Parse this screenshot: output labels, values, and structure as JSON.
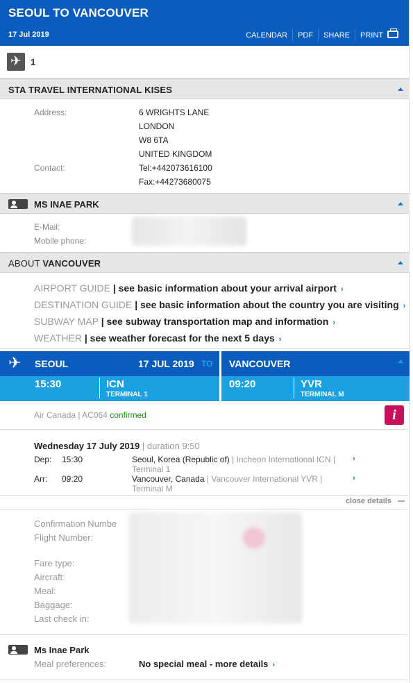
{
  "header": {
    "title": "SEOUL TO VANCOUVER",
    "date": "17 Jul 2019",
    "actions": [
      "CALENDAR",
      "PDF",
      "SHARE",
      "PRINT"
    ]
  },
  "flight_count": "1",
  "agency": {
    "title": "STA TRAVEL INTERNATIONAL KISES",
    "address_label": "Address:",
    "address_lines": [
      "6 WRIGHTS LANE",
      "LONDON",
      "W8 6TA",
      "UNITED KINGDOM"
    ],
    "contact_label": "Contact:",
    "tel": "Tel:+442073616100",
    "fax": "Fax:+44273680075"
  },
  "traveller": {
    "title": "MS INAE PARK",
    "email_label": "E-Mail:",
    "mobile_label": "Mobile phone:"
  },
  "about": {
    "prefix": "ABOUT ",
    "city": "VANCOUVER",
    "guides": [
      {
        "name": "AIRPORT GUIDE",
        "text": "| see basic information about your arrival airport"
      },
      {
        "name": "DESTINATION GUIDE",
        "text": "| see basic information about the country you are visiting"
      },
      {
        "name": "SUBWAY MAP",
        "text": "| see subway transportation map and information"
      },
      {
        "name": "WEATHER",
        "text": "| see weather forecast for the next 5 days"
      }
    ]
  },
  "flight": {
    "from_city": "SEOUL",
    "date": "17 JUL 2019",
    "to_word": "TO",
    "to_city": "VANCOUVER",
    "dep_time": "15:30",
    "dep_code": "ICN",
    "dep_terminal": "TERMINAL 1",
    "arr_time": "09:20",
    "arr_code": "YVR",
    "arr_terminal": "TERMINAL M",
    "airline": "Air Canada |",
    "flight_no": "AC064",
    "status": "confirmed",
    "info_glyph": "i",
    "day": "Wednesday 17 July 2019",
    "duration": "| duration 9:50",
    "dep_label": "Dep:",
    "dep_place": "Seoul, Korea (Republic of)",
    "dep_airport": "| Incheon International ICN |",
    "dep_term_line": "Terminal 1",
    "arr_label": "Arr:",
    "arr_place": "Vancouver, Canada",
    "arr_airport": "| Vancouver International YVR |",
    "arr_term_line": "Terminal M",
    "close_details": "close details"
  },
  "details": {
    "labels": [
      "Confirmation Numbe",
      "Flight Number:",
      "Fare type:",
      "Aircraft:",
      "Meal:",
      "Baggage:",
      "Last check in:"
    ]
  },
  "meal": {
    "name": "Ms Inae Park",
    "label": "Meal preferences:",
    "value": "No special meal - more details"
  },
  "colors": {
    "header_blue": "#0a5dbd",
    "light_blue": "#1ba1e2",
    "info_pink": "#c8105a",
    "confirmed_green": "#1a8a1a"
  }
}
